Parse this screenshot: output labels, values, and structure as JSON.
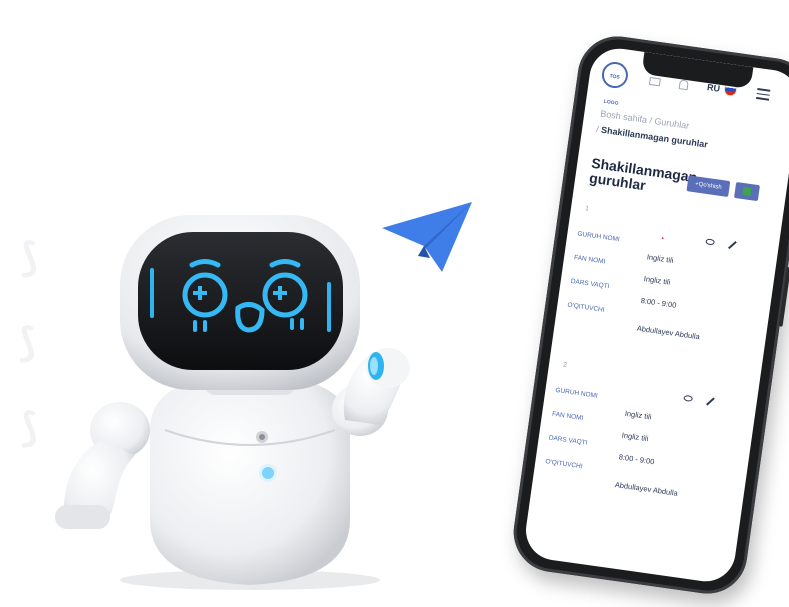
{
  "phone": {
    "header": {
      "logo_icon": "university-logo",
      "logo_text": "TOS LOGO",
      "mail_icon": "mail-icon",
      "bell_icon": "bell-icon",
      "language": "RU",
      "flag_icon": "russia-flag-icon",
      "menu_icon": "hamburger-menu-icon"
    },
    "breadcrumb": {
      "home": "Bosh sahifa",
      "sep": "/",
      "groups": "Guruhlar",
      "current": "Shakillanmagan guruhlar"
    },
    "page": {
      "title": "Shakillanmagan guruhlar",
      "add_button": "+Qo'shish",
      "export_icon": "excel-icon"
    },
    "groups": [
      {
        "index": "1",
        "labels": [
          "GURUH NOMI",
          "FAN NOMI",
          "DARS VAQTI",
          "O'QITUVCHI"
        ],
        "values": [
          "Ingliz tili",
          "Ingliz tili",
          "8:00 - 9:00",
          "Abdullayev Abdulla"
        ]
      },
      {
        "index": "2",
        "labels": [
          "GURUH NOMI",
          "FAN NOMI",
          "DARS VAQTI",
          "O'QITUVCHI"
        ],
        "values": [
          "Ingliz tili",
          "Ingliz tili",
          "8:00 - 9:00",
          "Abdullayev Abdulla"
        ]
      }
    ]
  },
  "colors": {
    "accent": "#5a6fb8",
    "label_blue": "#4a67b3",
    "text_dark": "#1f2a44",
    "plane_blue": "#3f7ee8",
    "robot_glow": "#2fb4f0"
  }
}
